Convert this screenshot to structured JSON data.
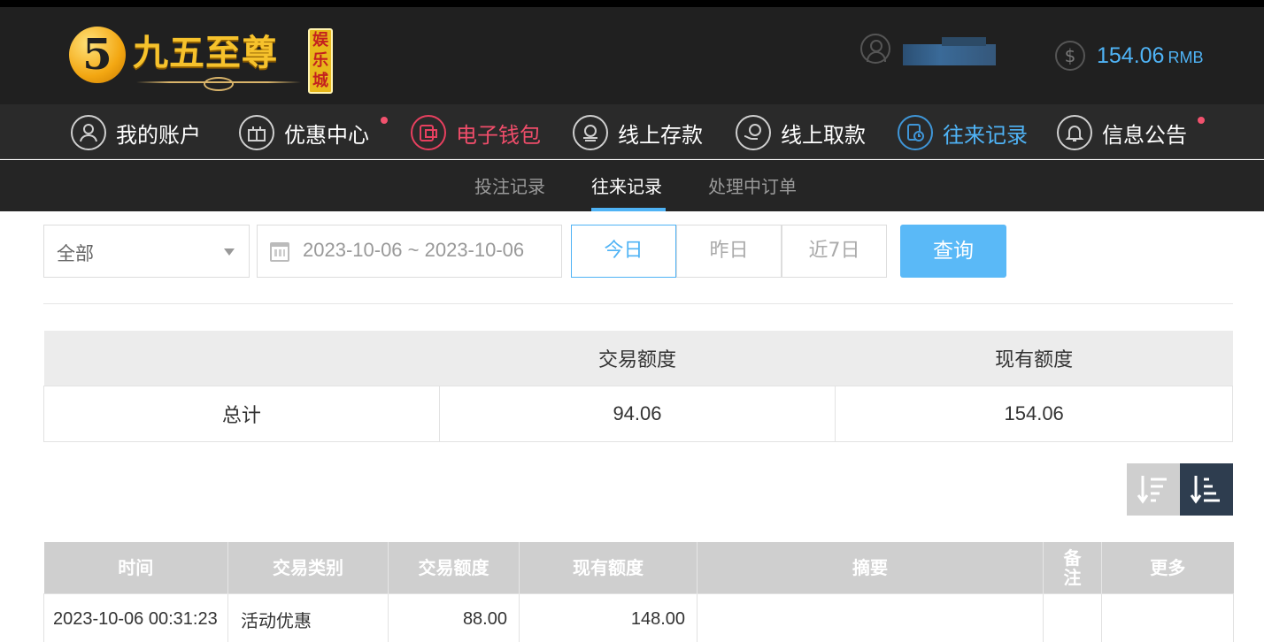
{
  "header": {
    "logo_mark": "5",
    "logo_name": "九五至尊",
    "logo_badge": [
      "娱",
      "乐",
      "城"
    ],
    "balance_value": "154.06",
    "balance_unit": "RMB"
  },
  "main_nav": [
    {
      "label": "我的账户",
      "icon": "user-icon",
      "state": "normal",
      "dot": false
    },
    {
      "label": "优惠中心",
      "icon": "gift-icon",
      "state": "normal",
      "dot": true
    },
    {
      "label": "电子钱包",
      "icon": "wallet-icon",
      "state": "red",
      "dot": false
    },
    {
      "label": "线上存款",
      "icon": "deposit-icon",
      "state": "normal",
      "dot": false
    },
    {
      "label": "线上取款",
      "icon": "withdraw-icon",
      "state": "normal",
      "dot": false
    },
    {
      "label": "往来记录",
      "icon": "records-icon",
      "state": "active",
      "dot": false
    },
    {
      "label": "信息公告",
      "icon": "bell-icon",
      "state": "normal",
      "dot": true
    }
  ],
  "sub_nav": {
    "tabs": [
      "投注记录",
      "往来记录",
      "处理中订单"
    ],
    "active_index": 1
  },
  "filters": {
    "type_select": "全部",
    "date_range": "2023-10-06 ~ 2023-10-06",
    "quick_ranges": [
      "今日",
      "昨日",
      "近7日"
    ],
    "quick_active_index": 0,
    "search_label": "查询"
  },
  "summary": {
    "headers": [
      "",
      "交易额度",
      "现有额度"
    ],
    "row": {
      "label": "总计",
      "transaction": "94.06",
      "current": "154.06"
    }
  },
  "records": {
    "headers": [
      "时间",
      "交易类别",
      "交易额度",
      "现有额度",
      "摘要",
      "备注",
      "更多"
    ],
    "rows": [
      {
        "time": "2023-10-06 00:31:23",
        "category": "活动优惠",
        "amount": "88.00",
        "balance": "148.00",
        "summary": "",
        "remark": "",
        "more": ""
      }
    ]
  },
  "colors": {
    "accent_blue": "#4fb3f5",
    "accent_red": "#ef4d6a",
    "header_bg": "#202020",
    "sort_desc_bg": "#2e3d4f"
  }
}
